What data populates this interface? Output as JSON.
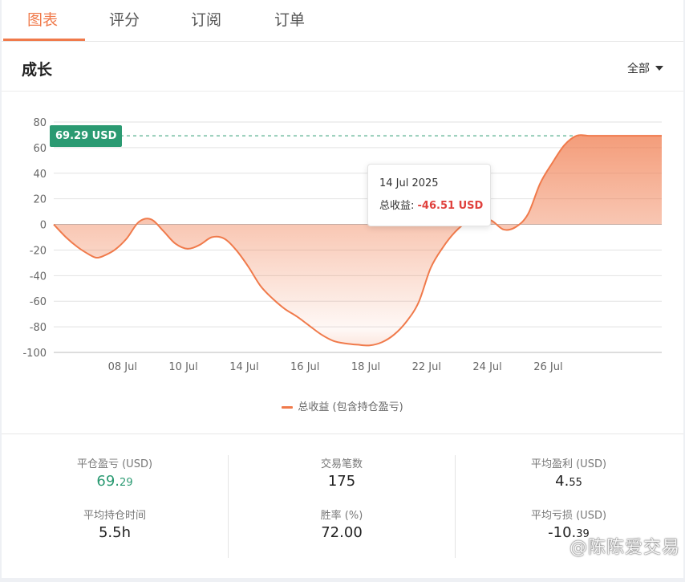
{
  "tabs": [
    {
      "label": "图表",
      "active": true
    },
    {
      "label": "评分",
      "active": false
    },
    {
      "label": "订阅",
      "active": false
    },
    {
      "label": "订单",
      "active": false
    }
  ],
  "section": {
    "title": "成长",
    "filter_label": "全部"
  },
  "tooltip": {
    "date": "14 Jul 2025",
    "label": "总收益:",
    "value": "-46.51 USD"
  },
  "last_value_badge": "69.29 USD",
  "legend": "总收益 (包含持仓盈亏)",
  "stats": {
    "col1": [
      {
        "label": "平仓盈亏 (USD)",
        "value_main": "69.",
        "value_small": "29",
        "green": true
      },
      {
        "label": "平均持仓时间",
        "value_main": "5.5h",
        "value_small": ""
      }
    ],
    "col2": [
      {
        "label": "交易笔数",
        "value_main": "175",
        "value_small": ""
      },
      {
        "label": "胜率 (%)",
        "value_main": "72.00",
        "value_small": ""
      }
    ],
    "col3": [
      {
        "label": "平均盈利 (USD)",
        "value_main": "4.",
        "value_small": "55"
      },
      {
        "label": "平均亏损 (USD)",
        "value_main": "-10.",
        "value_small": "39"
      }
    ]
  },
  "watermark": "@陈陈爱交易",
  "colors": {
    "accent": "#f07a4b",
    "green": "#2b9a72",
    "negative": "#e0413d"
  },
  "chart_data": {
    "type": "area",
    "series": [
      {
        "name": "总收益 (包含持仓盈亏)",
        "x": [
          6.0,
          6.4,
          6.8,
          7.2,
          7.4,
          7.6,
          8.0,
          8.4,
          8.8,
          9.2,
          9.6,
          10.0,
          10.4,
          10.8,
          11.2,
          11.6,
          12.0,
          12.4,
          12.8,
          13.2,
          13.6,
          14.0,
          14.4,
          14.8,
          15.2,
          15.6,
          16.0,
          16.4,
          16.8,
          17.2,
          17.6,
          18.0,
          18.4,
          18.8,
          19.2,
          19.6,
          20.0,
          20.4,
          20.8,
          21.2,
          21.6,
          22.0,
          22.4,
          22.8,
          23.2,
          23.6,
          24.0,
          24.4,
          24.8,
          25.2,
          25.6,
          26.0
        ],
        "y": [
          0,
          -10,
          -18,
          -24,
          -26,
          -25,
          -20,
          -11,
          2,
          4,
          -5,
          -15,
          -19,
          -16,
          -10,
          -11,
          -20,
          -33,
          -48,
          -58,
          -66,
          -72,
          -79,
          -86,
          -91,
          -93,
          -94,
          -94.5,
          -92,
          -86,
          -76,
          -61,
          -34,
          -18,
          -6,
          2,
          5,
          3,
          -4,
          -2,
          8,
          32,
          48,
          62,
          69.29,
          69.29,
          69.29,
          69.29,
          69.29,
          69.29,
          69.29,
          69.29
        ]
      }
    ],
    "x_ticks": [
      "08 Jul",
      "10 Jul",
      "14 Jul",
      "16 Jul",
      "18 Jul",
      "22 Jul",
      "24 Jul",
      "26 Jul"
    ],
    "y_ticks": [
      80,
      60,
      40,
      20,
      0,
      -20,
      -40,
      -60,
      -80,
      -100
    ],
    "ylim": [
      -100,
      80
    ],
    "grid": true,
    "reference_line": 69.29,
    "tooltip_point": {
      "x": "14 Jul 2025",
      "y": -46.51
    }
  }
}
